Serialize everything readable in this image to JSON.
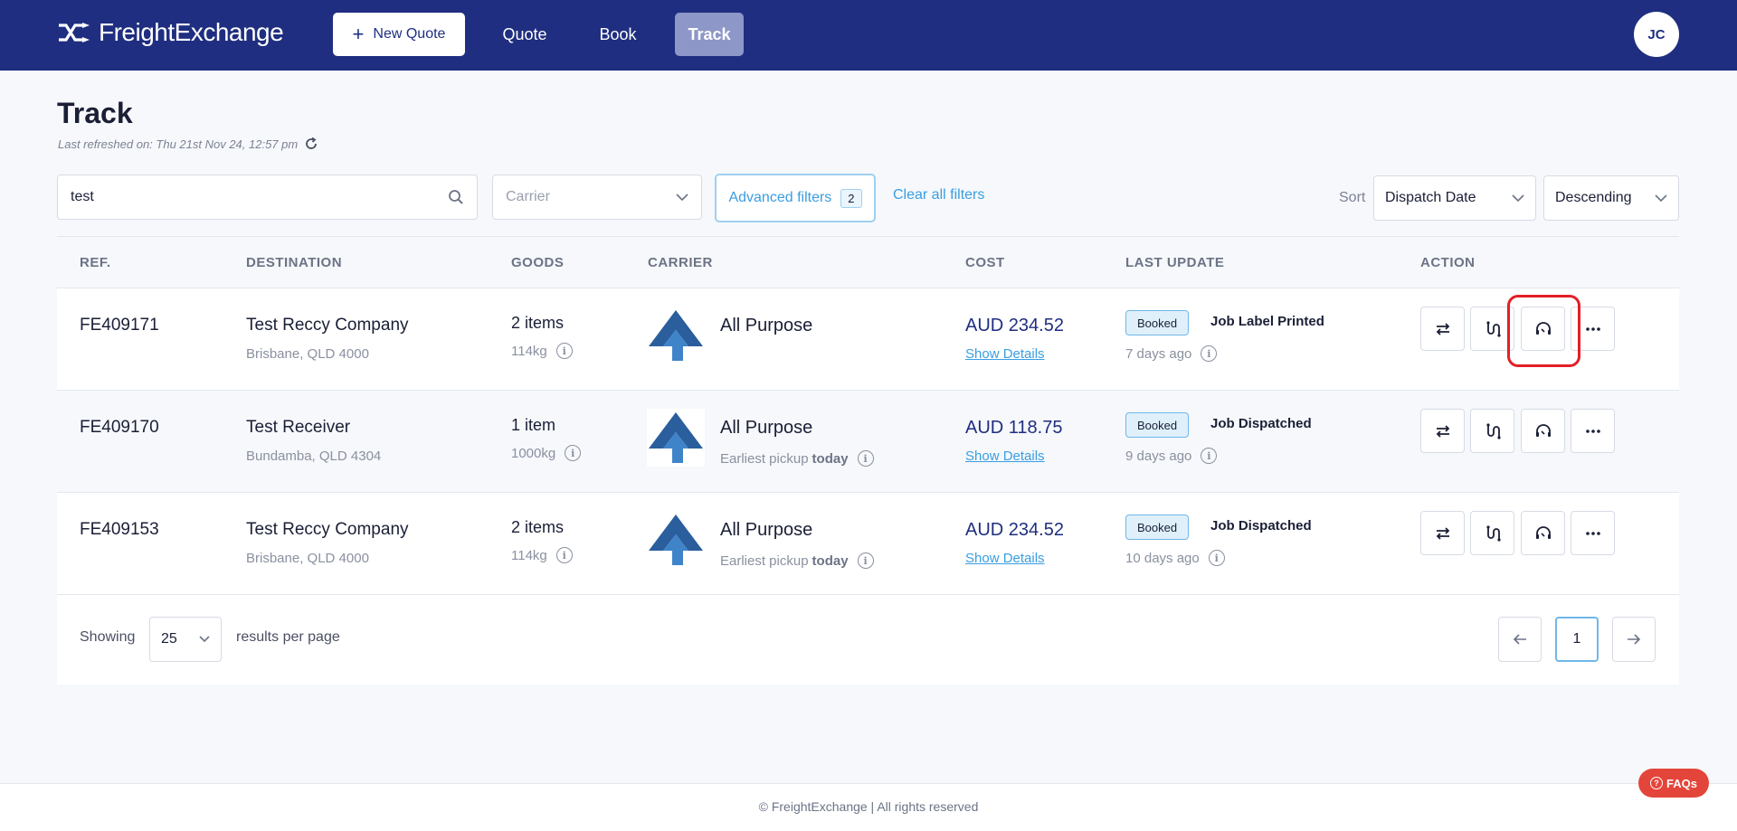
{
  "nav": {
    "brand": "FreightExchange",
    "new_quote": "New Quote",
    "links": [
      "Quote",
      "Book",
      "Track"
    ],
    "avatar_initials": "JC"
  },
  "header": {
    "title": "Track",
    "last_refreshed": "Last refreshed on: Thu 21st Nov 24, 12:57 pm"
  },
  "filters": {
    "search_value": "test",
    "carrier_placeholder": "Carrier",
    "advanced_label": "Advanced filters",
    "advanced_count": "2",
    "clear_label": "Clear all filters",
    "sort_label": "Sort",
    "sort_field": "Dispatch Date",
    "sort_order": "Descending"
  },
  "table": {
    "columns": [
      "REF.",
      "DESTINATION",
      "GOODS",
      "CARRIER",
      "COST",
      "LAST UPDATE",
      "ACTION"
    ],
    "rows": [
      {
        "ref": "FE409171",
        "dest_name": "Test Reccy Company",
        "dest_addr": "Brisbane, QLD 4000",
        "goods_count": "2 items",
        "goods_weight": "114kg",
        "carrier": "All Purpose",
        "pickup_prefix": "",
        "pickup_day": "",
        "cost": "AUD 234.52",
        "show_details": "Show Details",
        "status": "Booked",
        "status_text": "Job Label Printed",
        "age": "7 days ago"
      },
      {
        "ref": "FE409170",
        "dest_name": "Test Receiver",
        "dest_addr": "Bundamba, QLD 4304",
        "goods_count": "1 item",
        "goods_weight": "1000kg",
        "carrier": "All Purpose",
        "pickup_prefix": "Earliest pickup",
        "pickup_day": "today",
        "cost": "AUD 118.75",
        "show_details": "Show Details",
        "status": "Booked",
        "status_text": "Job Dispatched",
        "age": "9 days ago"
      },
      {
        "ref": "FE409153",
        "dest_name": "Test Reccy Company",
        "dest_addr": "Brisbane, QLD 4000",
        "goods_count": "2 items",
        "goods_weight": "114kg",
        "carrier": "All Purpose",
        "pickup_prefix": "Earliest pickup",
        "pickup_day": "today",
        "cost": "AUD 234.52",
        "show_details": "Show Details",
        "status": "Booked",
        "status_text": "Job Dispatched",
        "age": "10 days ago"
      }
    ]
  },
  "pagination": {
    "showing": "Showing",
    "per_page": "25",
    "results_label": "results per page",
    "current_page": "1"
  },
  "footer": {
    "copyright": "© FreightExchange | All rights reserved",
    "faqs": "FAQs"
  },
  "colors": {
    "nav_bg": "#1f2e80",
    "accent": "#3a9ee0",
    "highlight": "#e21f26",
    "faqs": "#e4453a"
  }
}
